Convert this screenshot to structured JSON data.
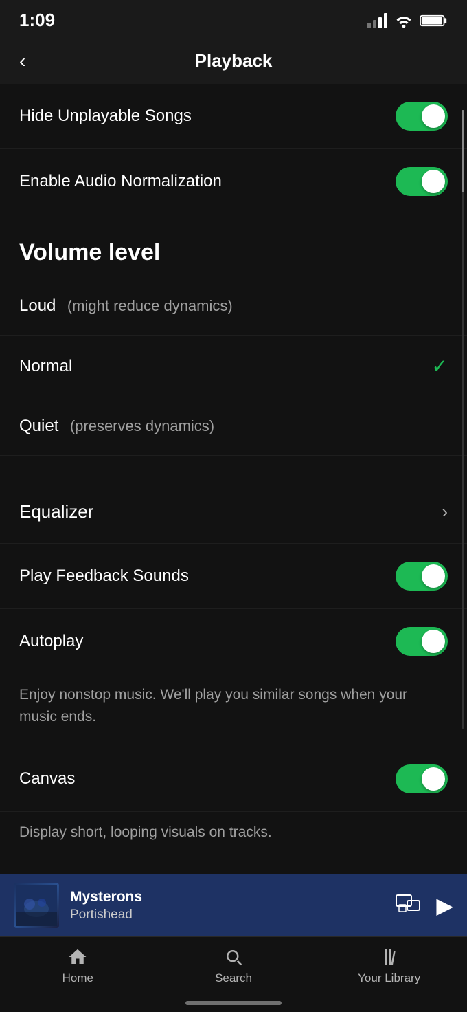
{
  "status": {
    "time": "1:09",
    "signal_bars": [
      2,
      3,
      4,
      5
    ],
    "wifi": true,
    "battery": true
  },
  "header": {
    "back_label": "<",
    "title": "Playback"
  },
  "settings": {
    "toggles": [
      {
        "id": "hide-unplayable",
        "label": "Hide Unplayable Songs",
        "enabled": true
      },
      {
        "id": "audio-normalization",
        "label": "Enable Audio Normalization",
        "enabled": true
      }
    ],
    "volume_section": {
      "heading": "Volume level",
      "options": [
        {
          "id": "loud",
          "label": "Loud",
          "sublabel": "(might reduce dynamics)",
          "selected": false
        },
        {
          "id": "normal",
          "label": "Normal",
          "sublabel": "",
          "selected": true
        },
        {
          "id": "quiet",
          "label": "Quiet",
          "sublabel": "(preserves dynamics)",
          "selected": false
        }
      ]
    },
    "equalizer_label": "Equalizer",
    "toggles2": [
      {
        "id": "play-feedback-sounds",
        "label": "Play Feedback Sounds",
        "enabled": true
      },
      {
        "id": "autoplay",
        "label": "Autoplay",
        "enabled": true
      }
    ],
    "autoplay_description": "Enjoy nonstop music. We'll play you similar songs when your music ends.",
    "canvas_toggle": {
      "id": "canvas",
      "label": "Canvas",
      "enabled": true
    },
    "canvas_description": "Display short, looping visuals on tracks."
  },
  "now_playing": {
    "title": "Mysterons",
    "artist": "Portishead"
  },
  "bottom_nav": {
    "items": [
      {
        "id": "home",
        "label": "Home",
        "active": false
      },
      {
        "id": "search",
        "label": "Search",
        "active": false
      },
      {
        "id": "library",
        "label": "Your Library",
        "active": false
      }
    ]
  }
}
